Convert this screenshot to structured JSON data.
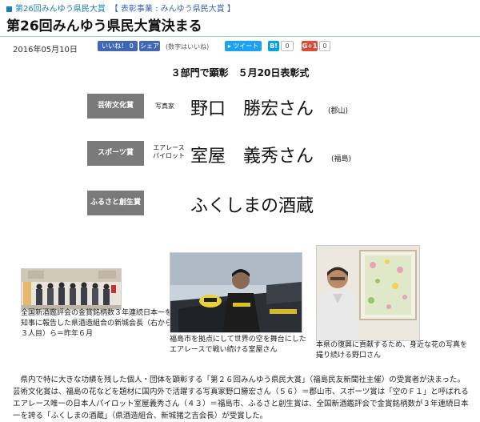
{
  "breadcrumb": {
    "first": "第26回みんゆう県民大賞",
    "category": "【 表彰事業 : みんゆう県民大賞 】"
  },
  "article": {
    "title": "第26回みんゆう県民大賞決まる",
    "date": "2016年05月10日"
  },
  "social": {
    "like_label": "いいね！ 0",
    "share_label": "シェア",
    "count_note": "(数字はいいね)",
    "tweet_label": "ツイート",
    "hatena_label": "B!",
    "hatena_count": "0",
    "gplus_label": "G+1",
    "gplus_count": "0"
  },
  "subheading": "３部門で顕彰　５月20日表彰式",
  "awards": [
    {
      "category": "芸術文化賞",
      "role": "写真家",
      "winner": "野口　勝宏さん",
      "place": "(郡山)"
    },
    {
      "category": "スポーツ賞",
      "role": "エアレース\nパイロット",
      "winner": "室屋　義秀さん",
      "place": "(福島)"
    },
    {
      "category": "ふるさと創生賞",
      "role": "",
      "winner": "ふくしまの酒蔵",
      "place": ""
    }
  ],
  "photos": [
    {
      "caption": "全国新酒鑑評会の金賞銘柄数３年連続日本一を知事に報告した県酒造組合の新城会長（右から３人目）ら＝昨年６月"
    },
    {
      "caption": "福島市を拠点にして世界の空を舞台にしたエアレースで戦い続ける室屋さん"
    },
    {
      "caption": "本県の復興に貢献するため、身近な花の写真を撮り続ける野口さん"
    }
  ],
  "body": "県内で特に大きな功績を残した個人・団体を顕彰する「第２６回みんゆう県民大賞」（福島民友新聞社主催）の受賞者が決まった。芸術文化賞は、福島の花などを題材に国内外で活躍する写真家野口勝宏さん（５６）＝郡山市、スポーツ賞は「空のＦ１」と呼ばれるエアレース唯一の日本人パイロット室屋義秀さん（４３）＝福島市、ふるさと創生賞は、全国新酒鑑評会で金賞銘柄数が３年連続日本一を誇る「ふくしまの酒蔵」（県酒造組合、新城猪之吉会長）が受賞した。",
  "colors": {
    "accent": "#1a7fb5",
    "label_bg": "#7a7a7a",
    "facebook": "#4267b2",
    "twitter": "#1da1f2"
  }
}
